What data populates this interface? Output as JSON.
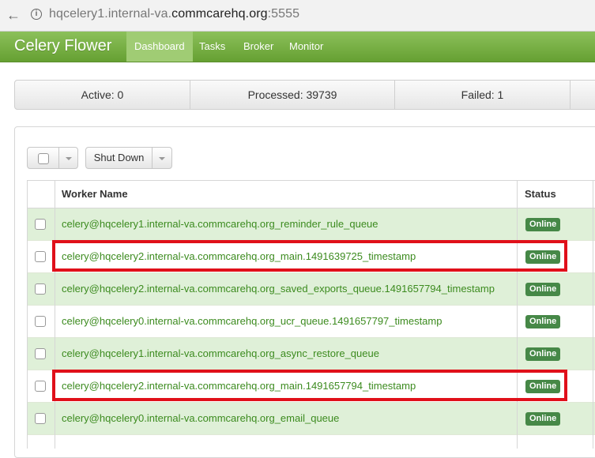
{
  "browser": {
    "url_prefix": "hqcelery1.internal-va.",
    "url_domain": "commcarehq.org",
    "url_suffix": ":5555",
    "back_icon": "back-arrow-icon",
    "info_icon": "info-icon"
  },
  "nav": {
    "brand": "Celery Flower",
    "items": [
      "Dashboard",
      "Tasks",
      "Broker",
      "Monitor"
    ],
    "active": "Dashboard"
  },
  "stats": {
    "active": "Active: 0",
    "processed": "Processed: 39739",
    "failed": "Failed: 1"
  },
  "toolbar": {
    "shutdown_label": "Shut Down"
  },
  "table": {
    "headers": {
      "worker": "Worker Name",
      "status": "Status"
    },
    "rows": [
      {
        "worker": "celery@hqcelery1.internal-va.commcarehq.org_reminder_rule_queue",
        "status": "Online",
        "highlighted": false
      },
      {
        "worker": "celery@hqcelery2.internal-va.commcarehq.org_main.1491639725_timestamp",
        "status": "Online",
        "highlighted": true
      },
      {
        "worker": "celery@hqcelery2.internal-va.commcarehq.org_saved_exports_queue.1491657794_timestamp",
        "status": "Online",
        "highlighted": false
      },
      {
        "worker": "celery@hqcelery0.internal-va.commcarehq.org_ucr_queue.1491657797_timestamp",
        "status": "Online",
        "highlighted": false
      },
      {
        "worker": "celery@hqcelery1.internal-va.commcarehq.org_async_restore_queue",
        "status": "Online",
        "highlighted": false
      },
      {
        "worker": "celery@hqcelery2.internal-va.commcarehq.org_main.1491657794_timestamp",
        "status": "Online",
        "highlighted": true
      },
      {
        "worker": "celery@hqcelery0.internal-va.commcarehq.org_email_queue",
        "status": "Online",
        "highlighted": false
      }
    ]
  },
  "colors": {
    "nav_green": "#66a032",
    "online_badge": "#468847",
    "highlight_red": "#e0101a",
    "link_green": "#3c8b1f"
  }
}
